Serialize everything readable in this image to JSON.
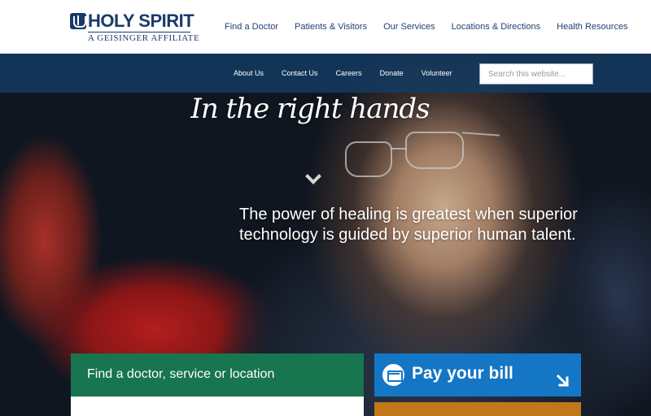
{
  "header": {
    "logo": {
      "name": "HOLY SPIRIT",
      "tagline": "A GEISINGER AFFILIATE",
      "icon": "holy-spirit-shield-icon",
      "color": "#1a3a6b"
    },
    "nav": [
      {
        "label": "Find a Doctor"
      },
      {
        "label": "Patients & Visitors"
      },
      {
        "label": "Our Services"
      },
      {
        "label": "Locations & Directions"
      },
      {
        "label": "Health Resources"
      }
    ]
  },
  "sub_nav": {
    "items": [
      {
        "label": "About Us"
      },
      {
        "label": "Contact Us"
      },
      {
        "label": "Careers"
      },
      {
        "label": "Donate"
      },
      {
        "label": "Volunteer"
      }
    ],
    "search": {
      "placeholder": "Search this website...",
      "value": ""
    }
  },
  "hero": {
    "headline": "In the right hands",
    "scroll_icon": "chevron-down-icon",
    "tagline": "The power of healing is greatest when superior technology is guided by superior human talent."
  },
  "cards": {
    "find": {
      "label": "Find a doctor, service or location",
      "color": "#17754f"
    },
    "pay": {
      "label": "Pay your bill",
      "icon": "credit-card-icon",
      "arrow_icon": "arrow-down-right-icon",
      "color": "#1476c4"
    },
    "orange": {
      "color": "#c07818"
    }
  }
}
